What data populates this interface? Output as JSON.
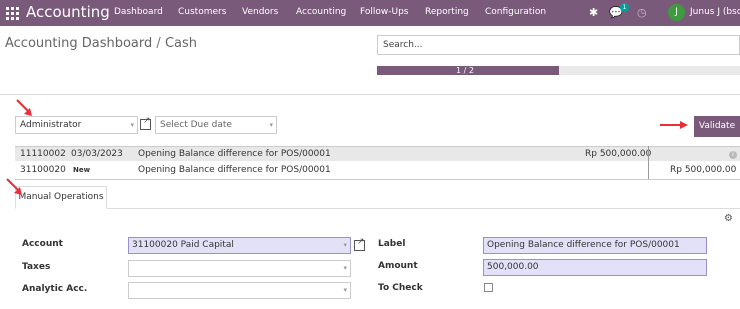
{
  "navbar": {
    "brand": "Accounting",
    "menu": [
      "Dashboard",
      "Customers",
      "Vendors",
      "Accounting",
      "Follow-Ups",
      "Reporting",
      "Configuration"
    ],
    "chat_badge": "1",
    "avatar_initial": "J",
    "user_name": "Junus J (bsd"
  },
  "control_panel": {
    "breadcrumb_root": "Accounting Dashboard",
    "breadcrumb_sep": "/",
    "breadcrumb_current": "Cash",
    "search_placeholder": "Search...",
    "progress_text": "1 / 2",
    "progress_value": 0.5
  },
  "filters": {
    "partner_value": "Administrator",
    "due_date_placeholder": "Select Due date",
    "validate_label": "Validate"
  },
  "lines": [
    {
      "account": "11110002",
      "date": "03/03/2023",
      "label": "Opening Balance difference for POS/00001",
      "debit": "Rp 500,000.00",
      "credit": ""
    },
    {
      "account": "31100020",
      "date": "New",
      "label": "Opening Balance difference for POS/00001",
      "debit": "",
      "credit": "Rp 500,000.00"
    }
  ],
  "tabs": {
    "manual_operations": "Manual Operations"
  },
  "form": {
    "account_label": "Account",
    "account_value": "31100020 Paid Capital",
    "taxes_label": "Taxes",
    "analytic_label": "Analytic Acc.",
    "label_label": "Label",
    "label_value": "Opening Balance difference for POS/00001",
    "amount_label": "Amount",
    "amount_value": "500,000.00",
    "to_check_label": "To Check"
  },
  "colors": {
    "brand": "#7a5a7a",
    "annotation_arrow": "#e8303a",
    "field_highlight": "#e3e1f8"
  }
}
